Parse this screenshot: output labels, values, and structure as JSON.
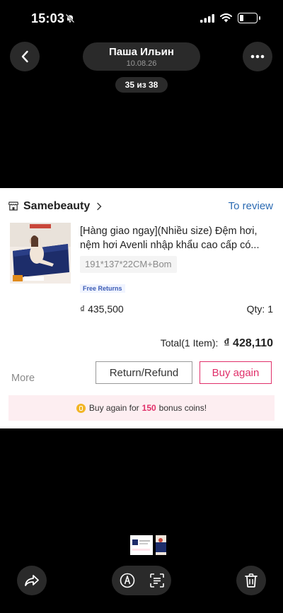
{
  "status_bar": {
    "time": "15:03"
  },
  "header": {
    "title": "Паша Ильин",
    "date": "10.08.26",
    "counter": "35 из 38"
  },
  "order": {
    "shop_name": "Samebeauty",
    "review_link": "To review",
    "product_title": "[Hàng giao ngay](Nhiều size) Đệm hơi, nệm hơi Avenli nhập khẩu cao cấp có...",
    "variant": "191*137*22CM+Bom",
    "badge": "Free Returns",
    "price": "₫ 435,500",
    "qty": "Qty: 1",
    "total_label": "Total(1 Item):",
    "total_amount": "₫ 428,110",
    "more": "More",
    "refund_button": "Return/Refund",
    "buy_again_button": "Buy again",
    "coin_prefix": "Buy again for",
    "coin_count": "150",
    "coin_suffix": "bonus coins!"
  },
  "colors": {
    "accent": "#e0306a",
    "link": "#2c6bb3",
    "coin_bar_bg": "#fdeef1"
  },
  "icons": [
    "bell-slash-icon",
    "signal-icon",
    "wifi-icon",
    "battery-icon",
    "back-arrow-icon",
    "more-dots-icon",
    "shop-icon",
    "chevron-right-icon",
    "coin-icon",
    "share-icon",
    "markup-icon",
    "text-scan-icon",
    "trash-icon"
  ]
}
